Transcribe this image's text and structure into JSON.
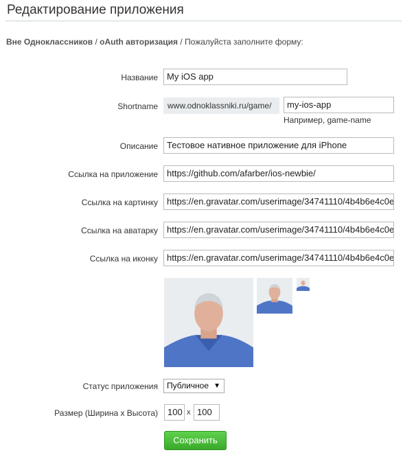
{
  "header": {
    "title": "Редактирование приложения"
  },
  "breadcrumb": {
    "part1": "Вне Одноклассников",
    "sep1": " / ",
    "part2": "oAuth авторизация",
    "sep2": " / ",
    "part3": "Пожалуйста заполните форму:"
  },
  "form": {
    "name_label": "Название",
    "name_value": "My iOS app",
    "shortname_label": "Shortname",
    "shortname_prefix": "www.odnoklassniki.ru/game/",
    "shortname_value": "my-ios-app",
    "shortname_hint": "Например, game-name",
    "description_label": "Описание",
    "description_value": "Тестовое нативное приложение для iPhone",
    "app_link_label": "Ссылка на приложение",
    "app_link_value": "https://github.com/afarber/ios-newbie/",
    "picture_link_label": "Ссылка на картинку",
    "picture_link_value": "https://en.gravatar.com/userimage/34741110/4b4b6e4c0e",
    "avatar_link_label": "Ссылка на аватарку",
    "avatar_link_value": "https://en.gravatar.com/userimage/34741110/4b4b6e4c0e",
    "icon_link_label": "Ссылка на иконку",
    "icon_link_value": "https://en.gravatar.com/userimage/34741110/4b4b6e4c0e",
    "status_label": "Статус приложения",
    "status_value": "Публичное",
    "size_label": "Размер (Ширина x Высота)",
    "width_value": "100",
    "size_separator": "x",
    "height_value": "100",
    "save_label": "Сохранить"
  }
}
